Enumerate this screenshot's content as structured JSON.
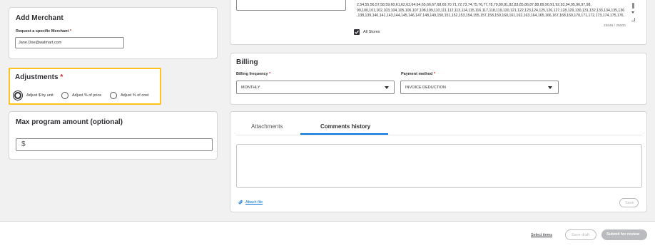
{
  "add_merchant": {
    "title": "Add Merchant",
    "field_label": "Request a specific Merchant",
    "required_mark": "*",
    "field_value": "Jane.Doe@walmart.com"
  },
  "adjustments": {
    "title": "Adjustments",
    "required_mark": "*",
    "options": [
      "Adjust $ by unit",
      "Adjust % of price",
      "Adjust % of cost"
    ]
  },
  "max_program": {
    "title": "Max program amount (optional)",
    "currency_symbol": "$"
  },
  "stores": {
    "lines": [
      "2,54,55,56,57,58,59,60,61,62,63,64,64,65,66,67,68,69,70,71,72,73,74,75,76,77,78,79,80,81,82,83,85,86,87,88,89,90,91,92,93,94,95,96,97,98,",
      "99,100,101,102,103,104,105,106,107,108,109,110,111,112,113,114,115,116,117,118,119,120,121,122,123,124,125,126,127,128,129,130,131,132,133,134,135,136,137",
      ",138,139,140,141,143,144,145,146,147,148,149,150,151,152,153,154,155,157,158,159,160,161,162,163,164,165,166,167,168,169,170,171,172,173,174,175,176,1"
    ],
    "char_count": "23646 / 25000",
    "all_stores_label": "All Stores"
  },
  "billing": {
    "title": "Billing",
    "frequency_label": "Billing frequency",
    "frequency_value": "MONTHLY",
    "payment_label": "Payment method",
    "payment_value": "INVOICE DEDUCTION",
    "required_mark": "*"
  },
  "comments": {
    "tabs": [
      "Attachments",
      "Comments history"
    ],
    "attach_label": "Attach file",
    "save_label": "Save"
  },
  "footer": {
    "select_items": "Select items",
    "save_draft": "Save draft",
    "submit": "Submit for review"
  },
  "colors": {
    "highlight": "#ffc220",
    "link": "#0071dc",
    "tab_active": "#0071dc",
    "disabled": "#babbbe"
  }
}
